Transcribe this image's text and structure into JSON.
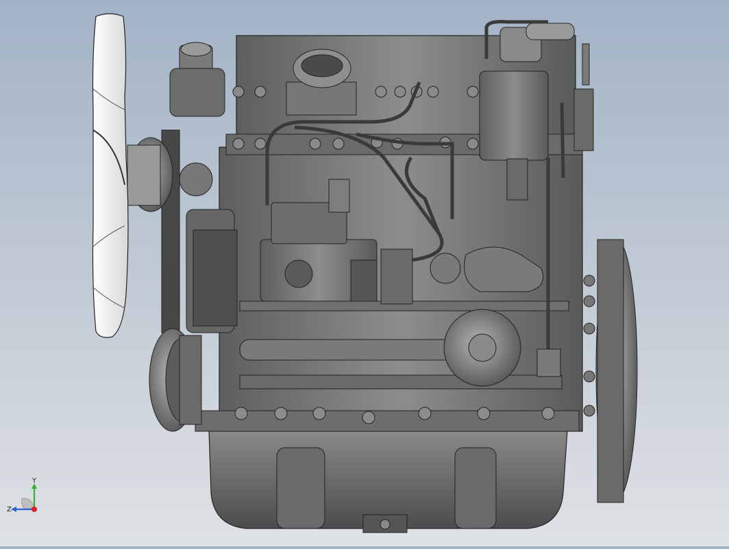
{
  "view": {
    "model": "engine-assembly",
    "background_top": "#a3b3c6",
    "background_bottom": "#dfe2e6",
    "render_style": "shaded-with-edges"
  },
  "triad": {
    "x_label": "",
    "y_label": "Y",
    "z_label": "Z",
    "y_color": "#2db52d",
    "z_color": "#2d5fd6",
    "origin_color": "#e02020"
  }
}
